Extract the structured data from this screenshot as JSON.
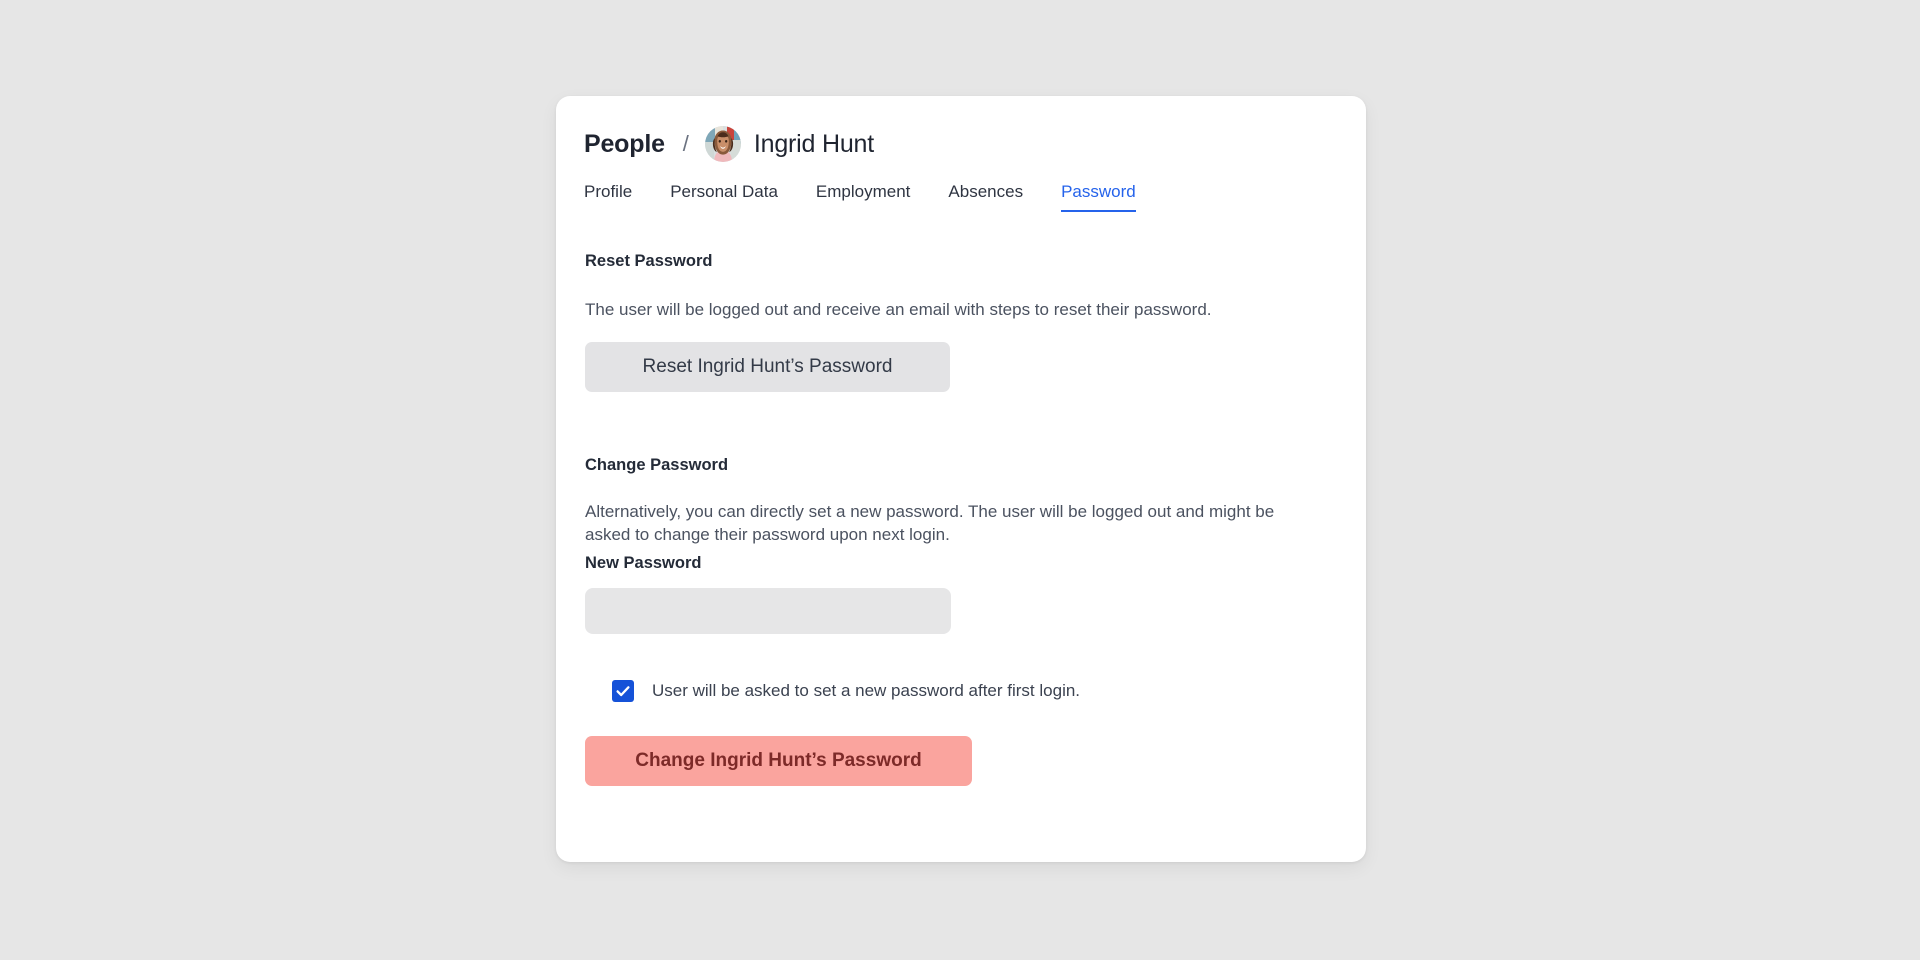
{
  "header": {
    "breadcrumb_root": "People",
    "breadcrumb_separator": "/",
    "person_name": "Ingrid Hunt",
    "avatar_alt": "Ingrid Hunt avatar"
  },
  "tabs": [
    {
      "label": "Profile",
      "active": false
    },
    {
      "label": "Personal Data",
      "active": false
    },
    {
      "label": "Employment",
      "active": false
    },
    {
      "label": "Absences",
      "active": false
    },
    {
      "label": "Password",
      "active": true
    }
  ],
  "reset_section": {
    "title": "Reset Password",
    "description": "The user will be logged out and receive an email with steps to reset their password.",
    "button_label": "Reset Ingrid Hunt’s Password"
  },
  "change_section": {
    "title": "Change Password",
    "description": "Alternatively, you can directly set a new password. The user will be logged out and might be asked to change their password upon next login.",
    "field_label": "New Password",
    "field_value": "",
    "field_placeholder": "",
    "checkbox_label": "User will be asked to set a new password after first login.",
    "checkbox_checked": "true",
    "button_label": "Change Ingrid Hunt’s Password"
  },
  "colors": {
    "page_background": "#e6e6e6",
    "card_background": "#ffffff",
    "accent_blue": "#2563eb",
    "checkbox_blue": "#1552d8",
    "danger_button_bg": "#faa49e",
    "danger_button_text": "#7d2a28",
    "neutral_button_bg": "#e3e3e5",
    "input_bg": "#e6e6e7",
    "text_primary": "#242b38",
    "text_secondary": "#4b5260"
  }
}
